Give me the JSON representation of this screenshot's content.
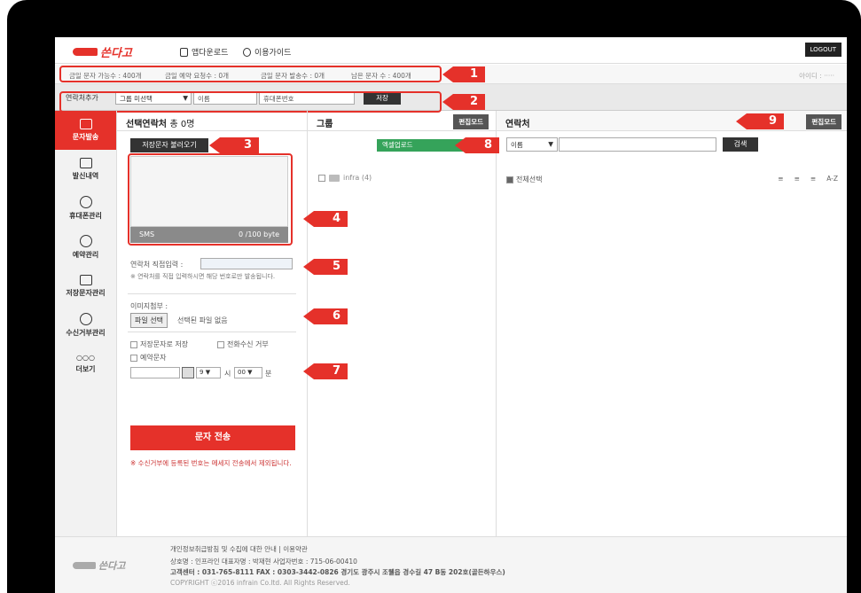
{
  "brand": {
    "name": "쓴다고",
    "accent": "#e5312a"
  },
  "topbar": {
    "app_download": "앱다운로드",
    "guide": "이용가이드",
    "logout": "LOGOUT"
  },
  "stats": {
    "available": "금일 문자 가능수 : 400개",
    "reserved": "금일 예약 요청수 : 0개",
    "sent": "금일 문자 발송수 : 0개",
    "remaining": "남은 문자 수 : 400개",
    "user_id": "아이디 : ·····"
  },
  "contact_add": {
    "label": "연락처추가",
    "group_select": "그룹 미선택",
    "name_placeholder": "이름",
    "phone_placeholder": "휴대폰번호",
    "save": "저장"
  },
  "callouts": [
    "1",
    "2",
    "3",
    "4",
    "5",
    "6",
    "7",
    "8",
    "9"
  ],
  "sidebar": {
    "items": [
      {
        "label": "문자발송",
        "icon": "envelope-icon"
      },
      {
        "label": "발신내역",
        "icon": "list-icon"
      },
      {
        "label": "휴대폰관리",
        "icon": "gear-icon"
      },
      {
        "label": "예약관리",
        "icon": "clock-icon"
      },
      {
        "label": "저장문자관리",
        "icon": "folder-icon"
      },
      {
        "label": "수신거부관리",
        "icon": "block-icon"
      },
      {
        "label": "더보기",
        "icon": "more-icon"
      }
    ]
  },
  "compose": {
    "title": "선택연락처",
    "count": "총 0명",
    "load_saved": "저장문자 불러오기",
    "sms_type": "SMS",
    "byte_count": "0 /100 byte",
    "direct_label": "연락처 직접입력 :",
    "direct_note": "※ 연락처를 직접 입력하시면 해당 번호로만 발송됩니다.",
    "image_label": "이미지첨부 :",
    "file_button": "파일 선택",
    "file_none": "선택된 파일 없음",
    "save_msg": "저장문자로 저장",
    "reject_call": "전화수신 거부",
    "reserve": "예약문자",
    "hour": "9",
    "hour_unit": "시",
    "minute": "00",
    "minute_unit": "분",
    "send": "문자 전송",
    "warning": "※ 수신거부에 등록된 번호는 메세지 전송에서 제외됩니다."
  },
  "group": {
    "title": "그룹",
    "edit": "편집모드",
    "excel": "엑셀업로드",
    "folder": "infra (4)"
  },
  "contacts": {
    "title": "연락처",
    "edit": "편집모드",
    "filter": "이름",
    "search": "검색",
    "select_all": "전체선택",
    "sort_labels": [
      "≡",
      "≡",
      "≡",
      "A-Z"
    ]
  },
  "footer": {
    "links": "개인정보취급방침 및 수집에 대한 안내 | 이용약관",
    "company": "상호명 : 인프라인    대표자명 : 박재현    사업자번호 : 715-06-00410",
    "contact": "고객센터 : 031-765-8111   FAX : 0303-3442-0826   경기도 광주시 조웰읍 경수길 47 B동 202호(골든하우스)",
    "copyright": "COPYRIGHT ⓒ2016 infrain Co.ltd. All Rights Reserved."
  }
}
